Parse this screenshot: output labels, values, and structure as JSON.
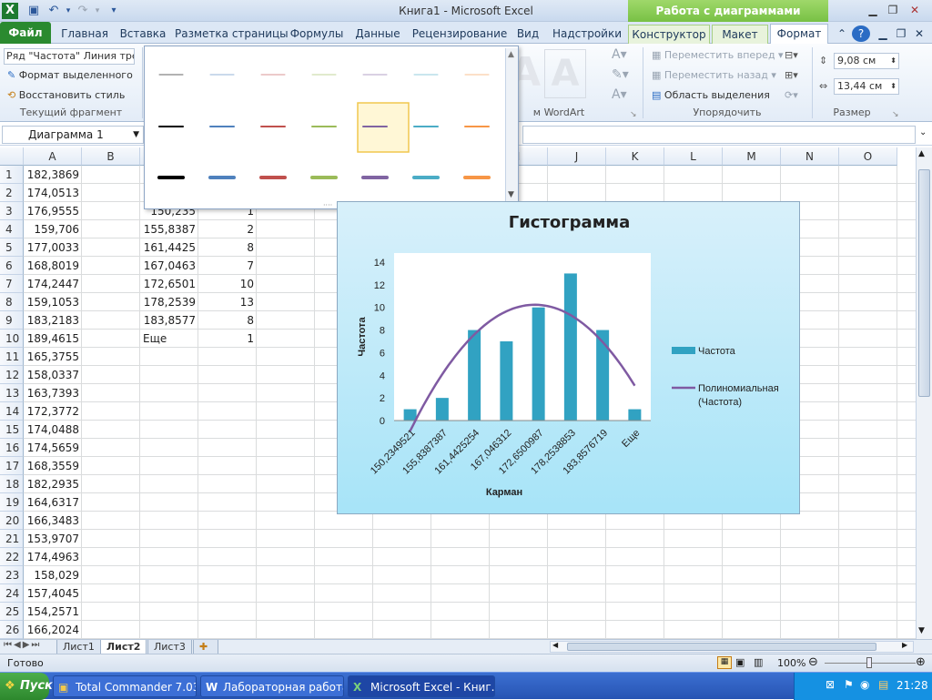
{
  "titlebar": {
    "title": "Книга1  -  Microsoft Excel",
    "ctx_header": "Работа с диаграммами"
  },
  "tabs": [
    "Файл",
    "Главная",
    "Вставка",
    "Разметка страницы",
    "Формулы",
    "Данные",
    "Рецензирование",
    "Вид",
    "Надстройки",
    "Конструктор",
    "Макет",
    "Формат"
  ],
  "ribbon": {
    "selection_dropdown": "Ряд \"Частота\" Линия тре",
    "format_selection": "Формат выделенного",
    "reset_style": "Восстановить стиль",
    "group_current": "Текущий фрагмент",
    "group_wordart": "Стили WordArt",
    "bring_forward": "Переместить вперед",
    "send_backward": "Переместить назад",
    "selection_pane": "Область выделения",
    "group_arrange": "Упорядочить",
    "height": "9,08 см",
    "width": "13,44 см",
    "group_size": "Размер"
  },
  "namebox": "Диаграмма 1",
  "columns": [
    "A",
    "B",
    "C",
    "D",
    "E",
    "F",
    "G",
    "H",
    "I",
    "J",
    "K",
    "L",
    "M",
    "N",
    "O"
  ],
  "col_a": [
    "182,3869",
    "174,0513",
    "176,9555",
    "159,706",
    "177,0033",
    "168,8019",
    "174,2447",
    "159,1053",
    "183,2183",
    "189,4615",
    "165,3755",
    "158,0337",
    "163,7393",
    "172,3772",
    "174,0488",
    "174,5659",
    "168,3559",
    "182,2935",
    "164,6317",
    "166,3483",
    "153,9707",
    "174,4963",
    "158,029",
    "157,4045",
    "154,2571",
    "166,2024"
  ],
  "col_c": [
    "",
    "",
    "150,235",
    "155,8387",
    "161,4425",
    "167,0463",
    "172,6501",
    "178,2539",
    "183,8577",
    "Еще"
  ],
  "col_c_row2": "К",
  "col_d": [
    "",
    "",
    "1",
    "2",
    "8",
    "7",
    "10",
    "13",
    "8",
    "1"
  ],
  "sheets": [
    "Лист1",
    "Лист2",
    "Лист3"
  ],
  "status": {
    "ready": "Готово",
    "zoom": "100%"
  },
  "taskbar": {
    "start": "Пуск",
    "items": [
      "Total Commander 7.03 - ...",
      "Лабораторная работа ...",
      "Microsoft Excel - Книг..."
    ],
    "lang": "RU",
    "clock": "21:28"
  },
  "gallery_colors": [
    "#000000",
    "#4f81bd",
    "#c0504d",
    "#9bbb59",
    "#8064a2",
    "#4bacc6",
    "#f79646"
  ],
  "chart_data": {
    "type": "bar",
    "title": "Гистограмма",
    "categories": [
      "150,2349521",
      "155,8387387",
      "161,4425254",
      "167,046312",
      "172,6500987",
      "178,2538853",
      "183,8576719",
      "Еще"
    ],
    "series": [
      {
        "name": "Частота",
        "values": [
          1,
          2,
          8,
          7,
          10,
          13,
          8,
          1
        ]
      }
    ],
    "trendline": {
      "name": "Полиномиальная (Частота)",
      "type": "polynomial"
    },
    "xlabel": "Карман",
    "ylabel": "Частота",
    "ylim": [
      0,
      14
    ],
    "yticks": [
      0,
      2,
      4,
      6,
      8,
      10,
      12,
      14
    ],
    "legend": "right",
    "grid": false,
    "bar_color": "#31a2c2",
    "trend_color": "#7f5aa2"
  }
}
